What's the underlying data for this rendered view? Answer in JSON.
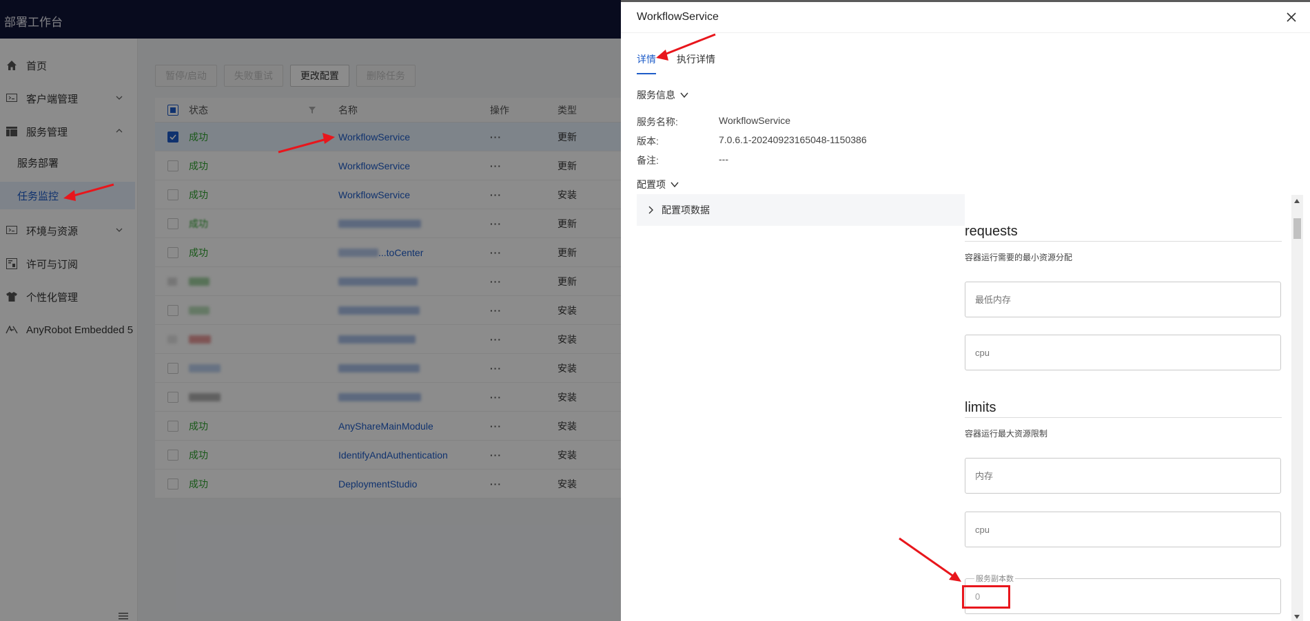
{
  "app": {
    "title": "部署工作台"
  },
  "sidebar": {
    "items": [
      {
        "label": "首页",
        "icon": "home-icon",
        "expandable": false
      },
      {
        "label": "客户端管理",
        "icon": "client-icon",
        "expandable": true,
        "expanded": false
      },
      {
        "label": "服务管理",
        "icon": "service-icon",
        "expandable": true,
        "expanded": true,
        "children": [
          {
            "label": "服务部署",
            "active": false
          },
          {
            "label": "任务监控",
            "active": true
          }
        ]
      },
      {
        "label": "环境与资源",
        "icon": "environment-icon",
        "expandable": true,
        "expanded": false
      },
      {
        "label": "许可与订阅",
        "icon": "license-icon",
        "expandable": false
      },
      {
        "label": "个性化管理",
        "icon": "personalize-icon",
        "expandable": false
      },
      {
        "label": "AnyRobot Embedded 5",
        "icon": "anyrobot-icon",
        "expandable": false
      }
    ]
  },
  "toolbar": {
    "pause_label": "暂停/启动",
    "retry_label": "失败重试",
    "config_label": "更改配置",
    "delete_label": "删除任务"
  },
  "table": {
    "columns": [
      "状态",
      "名称",
      "操作",
      "类型"
    ],
    "op_label": "···",
    "rows": [
      {
        "status": "成功",
        "name": "WorkflowService",
        "type": "更新",
        "selected": true
      },
      {
        "status": "成功",
        "name": "WorkflowService",
        "type": "更新"
      },
      {
        "status": "成功",
        "name": "WorkflowService",
        "type": "安装"
      },
      {
        "status": "成功",
        "name": "",
        "type": "更新",
        "blurred": true
      },
      {
        "status": "成功",
        "name": "...toCenter",
        "type": "更新",
        "partial_blur": true
      },
      {
        "status": "",
        "name": "",
        "type": "更新",
        "blurred": true
      },
      {
        "status": "",
        "name": "",
        "type": "安装",
        "blurred": true
      },
      {
        "status": "",
        "name": "",
        "type": "安装",
        "blurred": true
      },
      {
        "status": "",
        "name": "",
        "type": "安装",
        "blurred": true
      },
      {
        "status": "",
        "name": "",
        "type": "安装",
        "blurred": true
      },
      {
        "status": "成功",
        "name": "AnyShareMainModule",
        "type": "安装"
      },
      {
        "status": "成功",
        "name": "IdentifyAndAuthentication",
        "type": "安装"
      },
      {
        "status": "成功",
        "name": "DeploymentStudio",
        "type": "安装"
      }
    ]
  },
  "drawer": {
    "title": "WorkflowService",
    "tabs": [
      {
        "label": "详情",
        "active": true
      },
      {
        "label": "执行详情",
        "active": false
      }
    ],
    "service_info": {
      "heading": "服务信息",
      "fields": [
        {
          "label": "服务名称:",
          "value": "WorkflowService"
        },
        {
          "label": "版本:",
          "value": "7.0.6.1-20240923165048-1150386"
        },
        {
          "label": "备注:",
          "value": "---"
        }
      ]
    },
    "config": {
      "heading": "配置项",
      "data_row": "配置项数据"
    },
    "form": {
      "requests": {
        "title": "requests",
        "desc": "容器运行需要的最小资源分配",
        "memory_placeholder": "最低内存",
        "cpu_placeholder": "cpu"
      },
      "limits": {
        "title": "limits",
        "desc": "容器运行最大资源限制",
        "memory_placeholder": "内存",
        "cpu_placeholder": "cpu"
      },
      "replicas": {
        "label": "服务副本数",
        "value": "0"
      }
    }
  },
  "colors": {
    "header_bg": "#0f1437",
    "accent": "#1e5cc8",
    "success": "#2ea12e",
    "annotation": "#e8161c"
  }
}
